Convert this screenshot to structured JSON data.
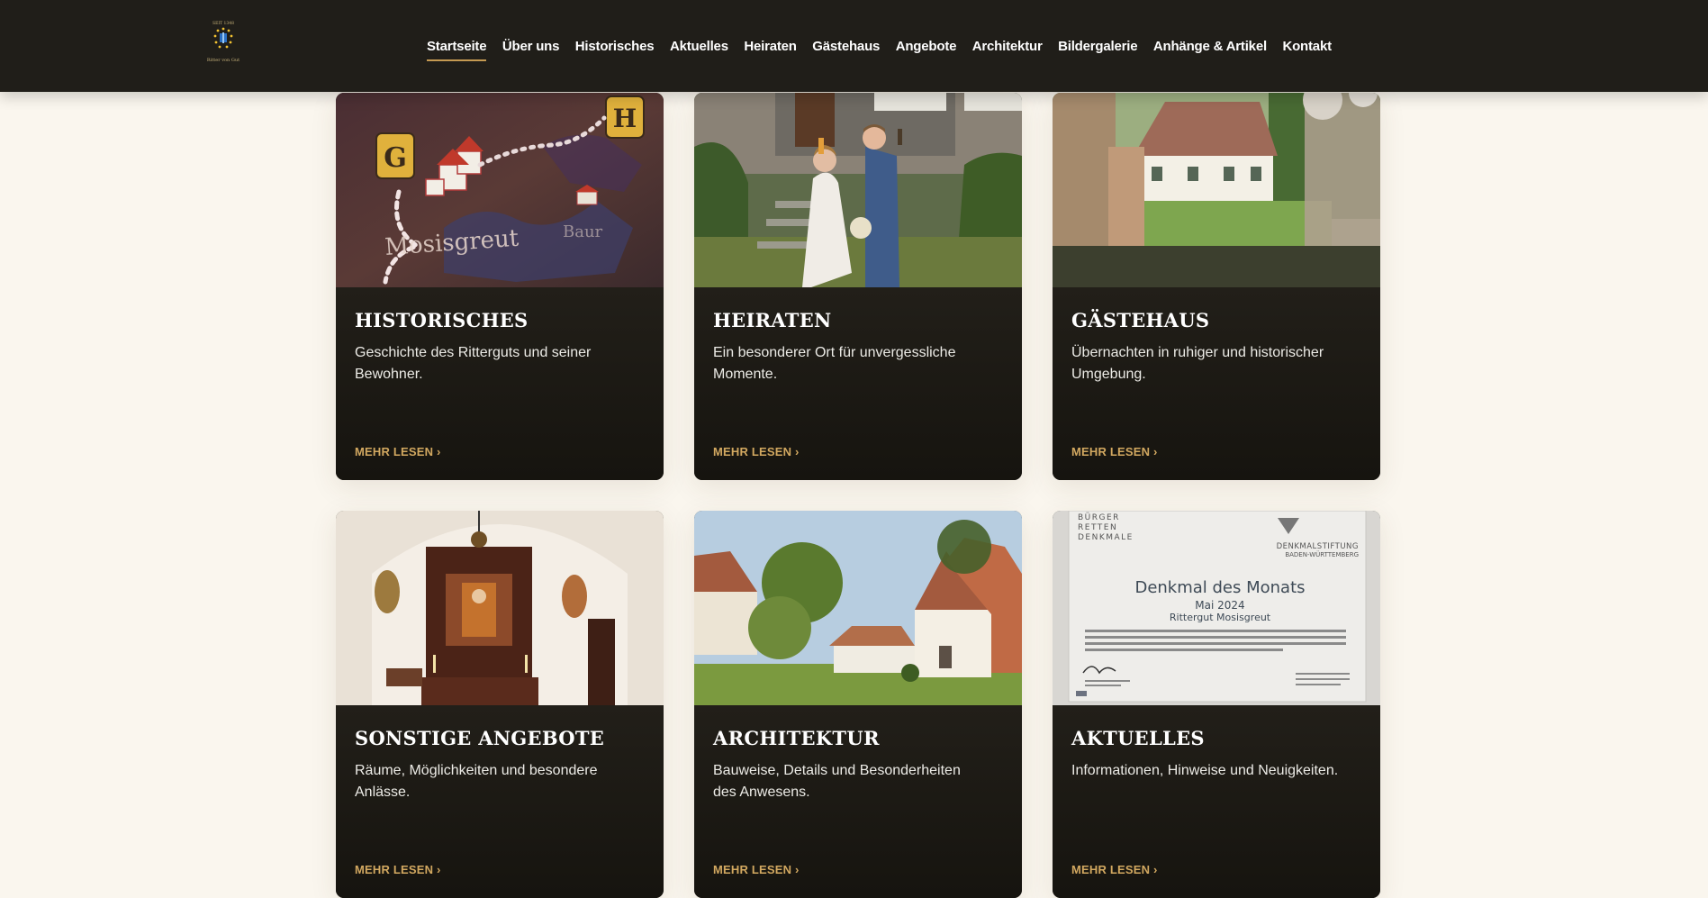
{
  "header": {
    "logo_top": "SEIT 1348",
    "logo_bottom": "Ritter von Gut",
    "nav": [
      {
        "label": "Startseite",
        "active": true
      },
      {
        "label": "Über uns"
      },
      {
        "label": "Historisches"
      },
      {
        "label": "Aktuelles"
      },
      {
        "label": "Heiraten"
      },
      {
        "label": "Gästehaus"
      },
      {
        "label": "Angebote"
      },
      {
        "label": "Architektur"
      },
      {
        "label": "Bildergalerie"
      },
      {
        "label": "Anhänge & Artikel"
      },
      {
        "label": "Kontakt"
      }
    ]
  },
  "cards": [
    {
      "title": "HISTORISCHES",
      "desc": "Geschichte des Ritterguts und seiner Bewohner.",
      "link": "MEHR LESEN ›",
      "image": {
        "map_letter_1": "G",
        "map_letter_2": "H",
        "map_town": "Mosisgreut",
        "map_side": "Baur"
      }
    },
    {
      "title": "HEIRATEN",
      "desc": "Ein besonderer Ort für unvergessliche Momente.",
      "link": "MEHR LESEN ›"
    },
    {
      "title": "GÄSTEHAUS",
      "desc": "Übernachten in ruhiger und historischer Umgebung.",
      "link": "MEHR LESEN ›"
    },
    {
      "title": "SONSTIGE ANGEBOTE",
      "desc": "Räume, Möglichkeiten und besondere Anlässe.",
      "link": "MEHR LESEN ›"
    },
    {
      "title": "ARCHITEKTUR",
      "desc": "Bauweise, Details und Besonderheiten des Anwesens.",
      "link": "MEHR LESEN ›"
    },
    {
      "title": "AKTUELLES",
      "desc": "Informationen, Hinweise und Neuigkeiten.",
      "link": "MEHR LESEN ›",
      "image": {
        "org_left_1": "BÜRGER",
        "org_left_2": "RETTEN",
        "org_left_3": "DENKMALE",
        "org_right_1": "DENKMALSTIFTUNG",
        "org_right_2": "BADEN-WÜRTTEMBERG",
        "heading": "Denkmal des Monats",
        "date": "Mai 2024",
        "place": "Rittergut Mosisgreut"
      }
    }
  ]
}
